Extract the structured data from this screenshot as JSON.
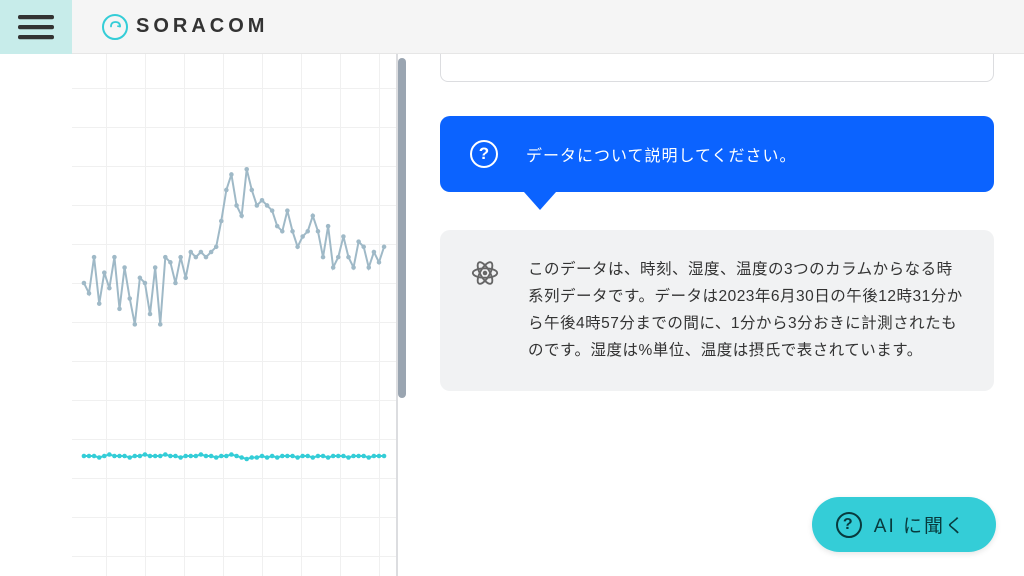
{
  "brand": {
    "name": "SORACOM"
  },
  "colors": {
    "accent_teal": "#34cdd7",
    "brand_blue": "#0b63ff",
    "grid_line": "#f0f0f0",
    "bubble_gray": "#f1f2f3",
    "text_dark": "#333333",
    "hamburger_bg": "#c7ecea"
  },
  "chat": {
    "user_prompt": "データについて説明してください。",
    "ai_response": "このデータは、時刻、湿度、温度の3つのカラムからなる時系列データです。データは2023年6月30日の午後12時31分から午後4時57分までの間に、1分から3分おきに計測されたものです。湿度は%単位、温度は摂氏で表されています。"
  },
  "ask_ai": {
    "label": "AI に聞く"
  },
  "chart_data": [
    {
      "type": "line",
      "title": "",
      "xlabel": "",
      "ylabel": "",
      "note": "upper jagged series (approx. temperature); values are approximate pixel-read estimates on an unlabeled axis",
      "color": "#9fb9c7",
      "x": [
        0,
        1,
        2,
        3,
        4,
        5,
        6,
        7,
        8,
        9,
        10,
        11,
        12,
        13,
        14,
        15,
        16,
        17,
        18,
        19,
        20,
        21,
        22,
        23,
        24,
        25,
        26,
        27,
        28,
        29,
        30,
        31,
        32,
        33,
        34,
        35,
        36,
        37,
        38,
        39,
        40,
        41,
        42,
        43,
        44,
        45,
        46,
        47,
        48,
        49,
        50,
        51,
        52,
        53,
        54,
        55,
        56,
        57,
        58,
        59
      ],
      "values": [
        46,
        42,
        56,
        38,
        50,
        44,
        56,
        36,
        52,
        40,
        30,
        48,
        46,
        34,
        52,
        30,
        56,
        54,
        46,
        56,
        48,
        58,
        56,
        58,
        56,
        58,
        60,
        70,
        82,
        88,
        76,
        72,
        90,
        82,
        76,
        78,
        76,
        74,
        68,
        66,
        74,
        66,
        60,
        64,
        66,
        72,
        66,
        56,
        68,
        52,
        56,
        64,
        56,
        52,
        62,
        60,
        52,
        58,
        54,
        60
      ]
    },
    {
      "type": "line",
      "title": "",
      "xlabel": "",
      "ylabel": "",
      "note": "lower near-flat series (approx. humidity); values are approximate pixel-read estimates on an unlabeled axis",
      "color": "#34cdd7",
      "x": [
        0,
        1,
        2,
        3,
        4,
        5,
        6,
        7,
        8,
        9,
        10,
        11,
        12,
        13,
        14,
        15,
        16,
        17,
        18,
        19,
        20,
        21,
        22,
        23,
        24,
        25,
        26,
        27,
        28,
        29,
        30,
        31,
        32,
        33,
        34,
        35,
        36,
        37,
        38,
        39,
        40,
        41,
        42,
        43,
        44,
        45,
        46,
        47,
        48,
        49,
        50,
        51,
        52,
        53,
        54,
        55,
        56,
        57,
        58,
        59
      ],
      "values": [
        9,
        9,
        9,
        8,
        9,
        10,
        9,
        9,
        9,
        8,
        9,
        9,
        10,
        9,
        9,
        9,
        10,
        9,
        9,
        8,
        9,
        9,
        9,
        10,
        9,
        9,
        8,
        9,
        9,
        10,
        9,
        8,
        7,
        8,
        8,
        9,
        8,
        9,
        8,
        9,
        9,
        9,
        8,
        9,
        9,
        8,
        9,
        9,
        8,
        9,
        9,
        9,
        8,
        9,
        9,
        9,
        8,
        9,
        9,
        9
      ]
    }
  ]
}
